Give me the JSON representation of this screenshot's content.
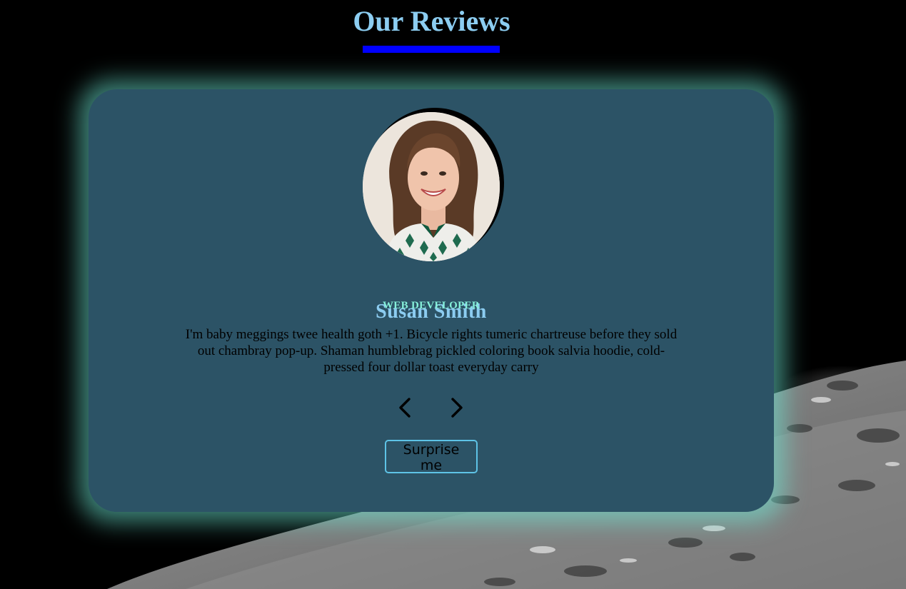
{
  "page": {
    "title": "Our Reviews",
    "accent_color": "#0000ff",
    "title_color": "#8ccdf1",
    "card_color": "#2c5366",
    "glow_color": "#6eebd7"
  },
  "review": {
    "name": "Susan Smith",
    "job": "WEB DEVELOPER",
    "text": "I'm baby meggings twee health goth +1. Bicycle rights tumeric chartreuse before they sold out chambray pop-up. Shaman humblebrag pickled coloring book salvia hoodie, cold-pressed four dollar toast everyday carry",
    "photo_alt": "Susan Smith"
  },
  "controls": {
    "prev_icon": "chevron-left-icon",
    "next_icon": "chevron-right-icon",
    "surprise_label": "Surprise me"
  }
}
